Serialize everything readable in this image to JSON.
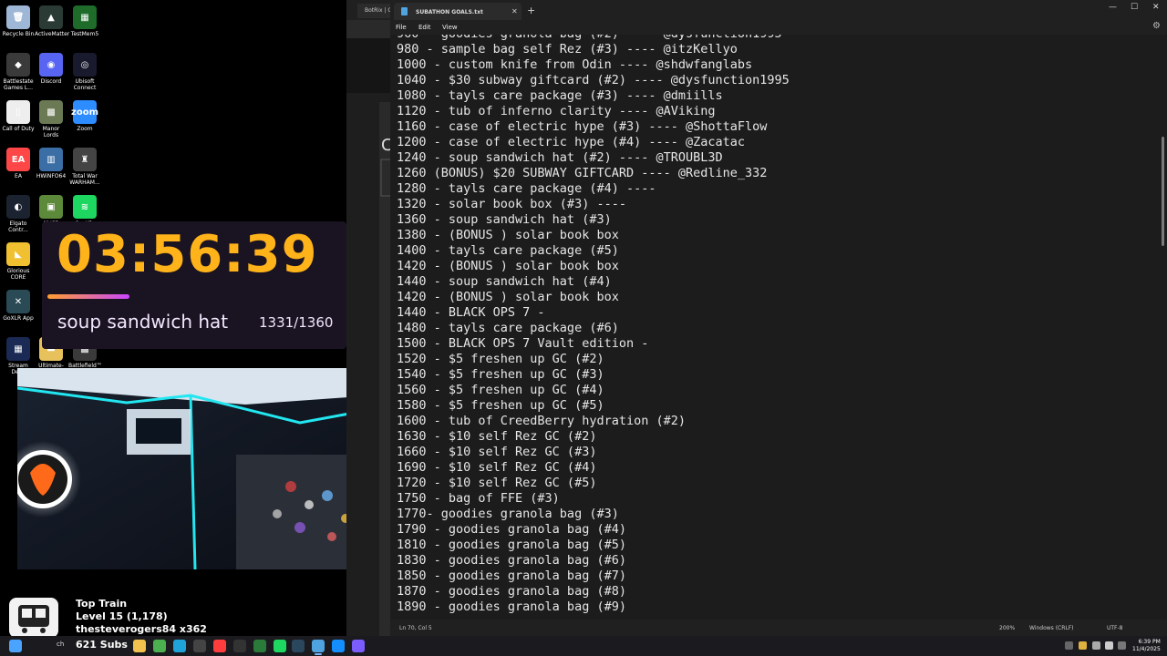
{
  "desktop": {
    "icons": [
      {
        "label": "Recycle Bin",
        "color": "#9fb7d6",
        "glyph": "🗑"
      },
      {
        "label": "ActiveMatter",
        "color": "#2a3b36",
        "glyph": "▲"
      },
      {
        "label": "TestMem5",
        "color": "#1e6b2a",
        "glyph": "▦"
      },
      {
        "label": "Battlestate Games L...",
        "color": "#3a3a3a",
        "glyph": "◆"
      },
      {
        "label": "Discord",
        "color": "#5865f2",
        "glyph": "◉"
      },
      {
        "label": "Ubisoft Connect",
        "color": "#1a1a2e",
        "glyph": "◎"
      },
      {
        "label": "Call of Duty",
        "color": "#eeeeee",
        "glyph": "▯"
      },
      {
        "label": "Manor Lords",
        "color": "#6b7a55",
        "glyph": "▩"
      },
      {
        "label": "Zoom",
        "color": "#2d8cff",
        "glyph": "zoom"
      },
      {
        "label": "EA",
        "color": "#ff4747",
        "glyph": "EA"
      },
      {
        "label": "HWiNFO64",
        "color": "#3a6ea5",
        "glyph": "▥"
      },
      {
        "label": "Total War WARHAM...",
        "color": "#444444",
        "glyph": "♜"
      },
      {
        "label": "Elgato Contr...",
        "color": "#1b2230",
        "glyph": "◐"
      },
      {
        "label": "NVCP",
        "color": "#5c8a3a",
        "glyph": "▣"
      },
      {
        "label": "Spotify",
        "color": "#1ed760",
        "glyph": "≋"
      },
      {
        "label": "Glorious CORE",
        "color": "#f0c030",
        "glyph": "◣"
      },
      {
        "label": "GoXLR App",
        "color": "#2a4a55",
        "glyph": "✕"
      },
      {
        "label": "Stream Deck",
        "color": "#1b2a55",
        "glyph": "▦"
      },
      {
        "label": "Ultimate-W...",
        "color": "#e6c15c",
        "glyph": "▬"
      },
      {
        "label": "Battlefield™ 6",
        "color": "#3a3a3a",
        "glyph": "▩"
      }
    ]
  },
  "overlay": {
    "timer": "03:56:39",
    "goal_name": "soup sandwich hat",
    "goal_count": "1331/1360",
    "goal_progress_fraction": 0.28
  },
  "top_train": {
    "title": "Top Train",
    "level": "Level 15  (1,178)",
    "user": "thesteverogers84 x362",
    "subs": "621 Subs"
  },
  "bg_window": {
    "tab_title": "BotRix | C"
  },
  "notepad": {
    "tab_title": "SUBATHON GOALS.txt",
    "new_tab": "+",
    "win_minimize": "—",
    "win_maximize": "☐",
    "win_close": "✕",
    "menu": [
      "File",
      "Edit",
      "View"
    ],
    "lines": [
      "960 - goodies granola bag (#2) ---- @dysfunction1995",
      "980 - sample bag self Rez (#3) ---- @itzKellyo",
      "1000 - custom knife from Odin ---- @shdwfanglabs",
      "1040 - $30 subway giftcard (#2) ---- @dysfunction1995",
      "1080 - tayls care package (#3) ---- @dmiills",
      "1120 - tub of inferno clarity ---- @AViking",
      "1160 - case of electric hype (#3) ---- @ShottaFlow",
      "1200 - case of electric hype (#4) ---- @Zacatac",
      "1240 - soup sandwich hat (#2) ---- @TROUBL3D",
      "1260 (BONUS) $20 SUBWAY GIFTCARD ---- @Redline_332",
      "1280 - tayls care package (#4) ----",
      "1320 - solar book box (#3) ----",
      "1360 - soup sandwich hat (#3)",
      "1380 - (BONUS ) solar book box",
      "1400 - tayls care package (#5)",
      "1420 - (BONUS ) solar book box",
      "1440 - soup sandwich hat (#4)",
      "1420 - (BONUS ) solar book box",
      "1440 - BLACK OPS 7 -",
      "1480 - tayls care package (#6)",
      "1500 - BLACK OPS 7 Vault edition -",
      "1520 - $5 freshen up GC (#2)",
      "1540 - $5 freshen up GC (#3)",
      "1560 - $5 freshen up GC (#4)",
      "1580 - $5 freshen up GC (#5)",
      "1600 - tub of CreedBerry hydration (#2)",
      "1630 - $10 self Rez GC (#2)",
      "1660 - $10 self Rez GC (#3)",
      "1690 - $10 self Rez GC (#4)",
      "1720 - $10 self Rez GC (#5)",
      "1750 - bag of FFE (#3)",
      "1770- goodies granola bag (#3)",
      "1790 - goodies granola bag (#4)",
      "1810 - goodies granola bag (#5)",
      "1830 - goodies granola bag (#6)",
      "1850 - goodies granola bag (#7)",
      "1870 - goodies granola bag (#8)",
      "1890 - goodies granola bag (#9)"
    ],
    "status": {
      "position": "Ln 70, Col 5",
      "zoom": "200%",
      "line_ending": "Windows (CRLF)",
      "encoding": "UTF-8"
    }
  },
  "taskbar": {
    "search_label": "ch",
    "time": "6:39 PM",
    "date": "11/4/2025",
    "apps": [
      {
        "name": "file-explorer",
        "color": "#f2c14e"
      },
      {
        "name": "chrome",
        "color": "#4caf50"
      },
      {
        "name": "edge",
        "color": "#1fa3d8"
      },
      {
        "name": "obs",
        "color": "#444"
      },
      {
        "name": "adobe",
        "color": "#ff3d3d"
      },
      {
        "name": "terminal",
        "color": "#333"
      },
      {
        "name": "xbox",
        "color": "#2a7a3a"
      },
      {
        "name": "spotify",
        "color": "#1ed760"
      },
      {
        "name": "steam",
        "color": "#2a475e"
      },
      {
        "name": "notepad",
        "color": "#4fa3e0"
      },
      {
        "name": "battle-net",
        "color": "#148eff"
      },
      {
        "name": "streamlabs",
        "color": "#7b5cff"
      }
    ]
  }
}
